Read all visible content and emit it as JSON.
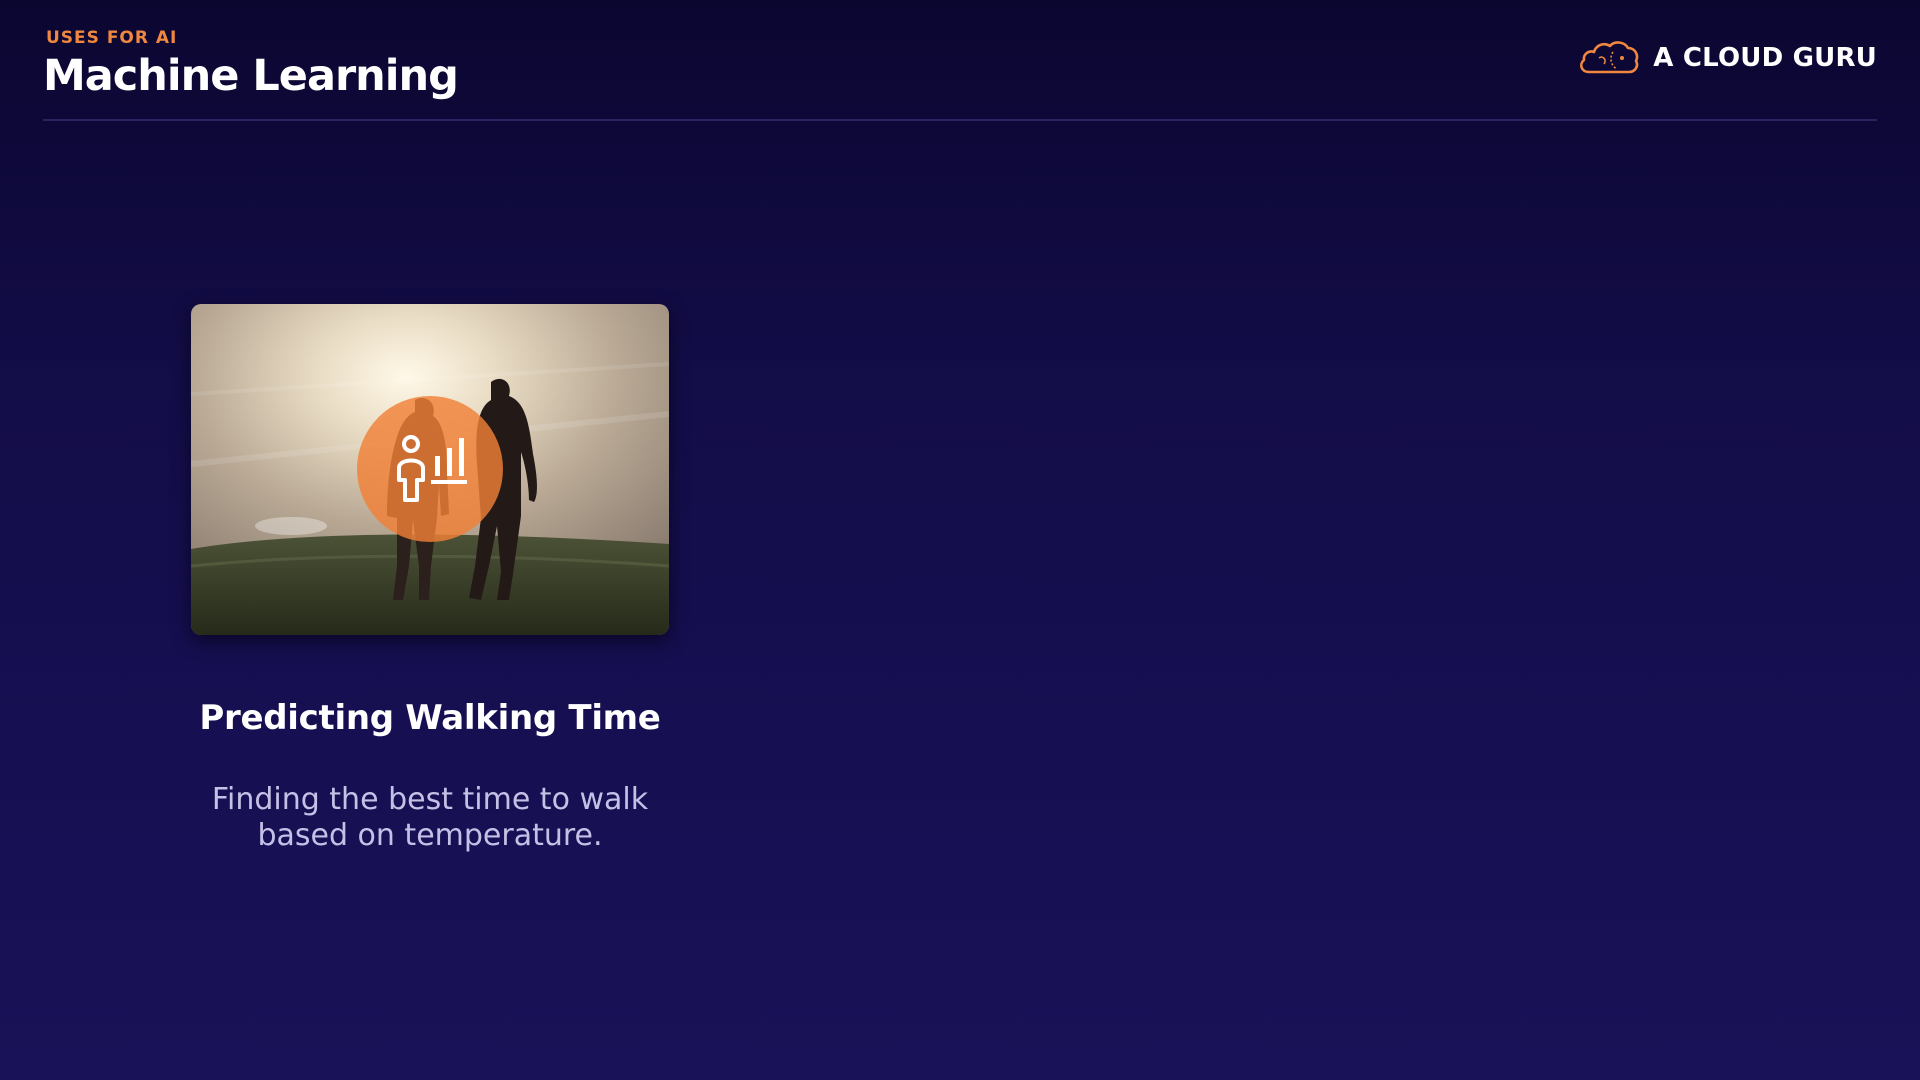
{
  "header": {
    "eyebrow": "USES FOR AI",
    "title": "Machine Learning"
  },
  "brand": {
    "name": "A CLOUD GURU",
    "logo_icon": "cloud-logo-icon",
    "accent_color": "#f0873f"
  },
  "card": {
    "image_alt_icon": "person-chart-icon",
    "title": "Predicting Walking Time",
    "description": "Finding the best time to walk based on temperature."
  },
  "colors": {
    "background_top": "#0b0630",
    "background_bottom": "#1a1258",
    "accent": "#f0873f",
    "description_text": "#c5c0e6"
  }
}
